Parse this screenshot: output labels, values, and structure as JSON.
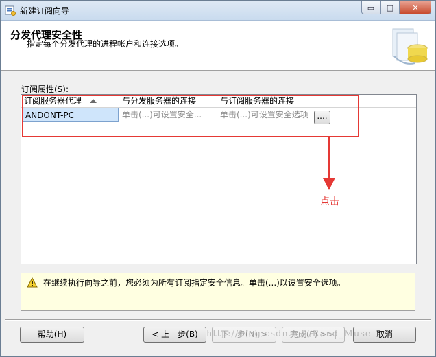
{
  "window": {
    "title": "新建订阅向导",
    "controls": {
      "minimize": "▭",
      "maximize": "□",
      "close": "✕"
    }
  },
  "header": {
    "title": "分发代理安全性",
    "subtitle": "指定每个分发代理的进程帐户和连接选项。"
  },
  "properties": {
    "label": "订阅属性(S):",
    "columns": [
      "订阅服务器代理",
      "与分发服务器的连接",
      "与订阅服务器的连接"
    ],
    "rows": [
      {
        "agent": "ANDONT-PC",
        "distributor_conn": "单击(...)可设置安全...",
        "subscriber_conn": "单击(...)可设置安全选项"
      }
    ],
    "ellipsis_button": "...."
  },
  "annotation": {
    "label": "点击",
    "color": "#e53935"
  },
  "info": {
    "icon": "warning-icon",
    "text": "在继续执行向导之前，您必须为所有订阅指定安全信息。单击(...)以设置安全选项。"
  },
  "buttons": {
    "help": "帮助(H)",
    "back": "< 上一步(B)",
    "next": "下一步(N) >",
    "finish": "完成(F) >>|",
    "cancel": "取消"
  },
  "watermark": "http://blog.csdn.net/Rand_Muse"
}
